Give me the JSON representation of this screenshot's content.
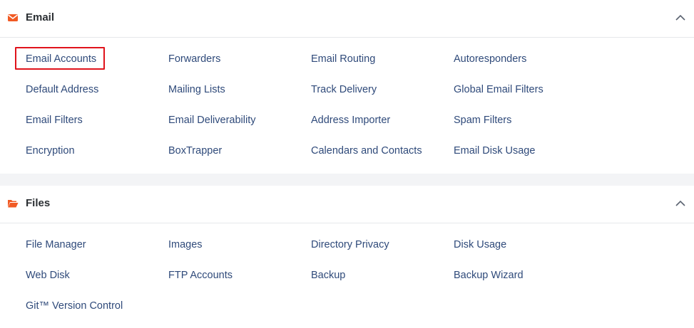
{
  "email": {
    "title": "Email",
    "icon": "envelope-icon",
    "accent": "#f15a24",
    "items": [
      "Email Accounts",
      "Forwarders",
      "Email Routing",
      "Autoresponders",
      "Default Address",
      "Mailing Lists",
      "Track Delivery",
      "Global Email Filters",
      "Email Filters",
      "Email Deliverability",
      "Address Importer",
      "Spam Filters",
      "Encryption",
      "BoxTrapper",
      "Calendars and Contacts",
      "Email Disk Usage"
    ],
    "highlighted_item": "Email Accounts"
  },
  "files": {
    "title": "Files",
    "icon": "folder-open-icon",
    "accent": "#f15a24",
    "items": [
      "File Manager",
      "Images",
      "Directory Privacy",
      "Disk Usage",
      "Web Disk",
      "FTP Accounts",
      "Backup",
      "Backup Wizard",
      "Git™ Version Control"
    ]
  },
  "colors": {
    "link": "#2f4a7a",
    "highlight_border": "#e0131b",
    "background": "#f3f4f6"
  }
}
